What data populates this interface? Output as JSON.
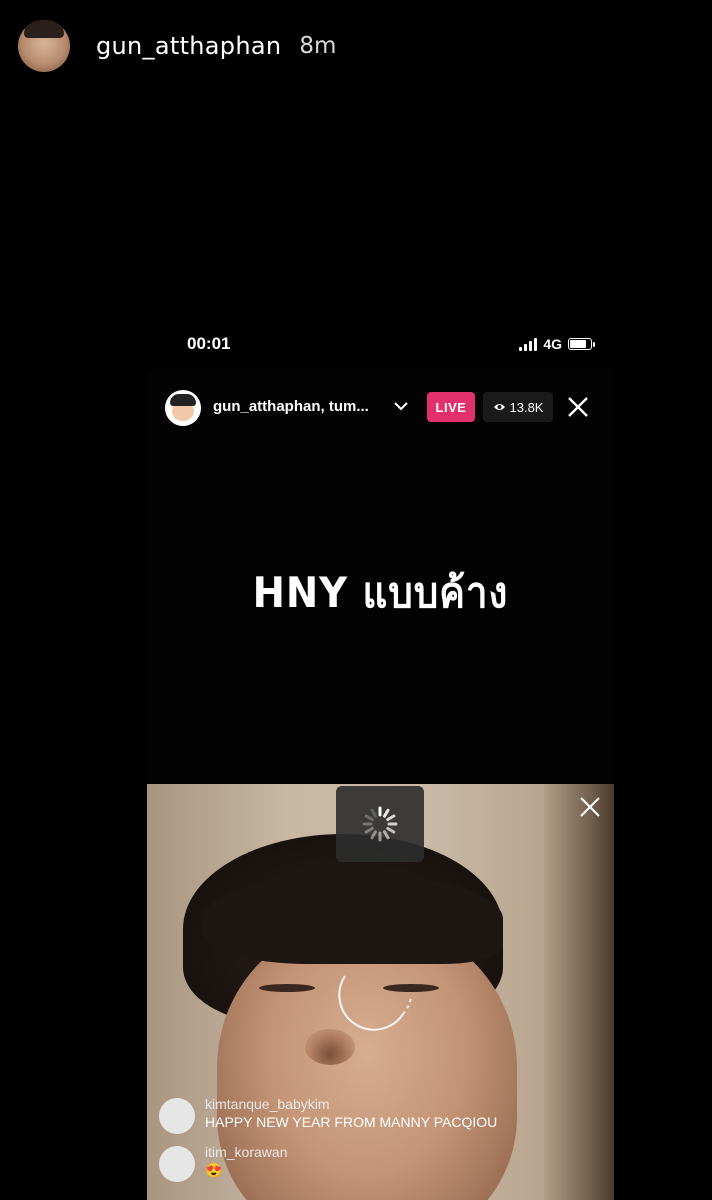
{
  "story": {
    "username": "gun_atthaphan",
    "time_ago": "8m",
    "avatar_icon": "profile-photo"
  },
  "status_bar": {
    "time": "00:01",
    "network": "4G",
    "signal_bars": 4,
    "battery_level": 0.8
  },
  "live": {
    "host_names": "gun_atthaphan, tum...",
    "badge": "LIVE",
    "viewers": "13.8K",
    "badge_color": "#e1306c",
    "caption": "HNY แบบค้าง"
  },
  "comments": [
    {
      "user": "kimtanque_babykim",
      "text": "HAPPY NEW YEAR FROM MANNY PACQIOU"
    },
    {
      "user": "itim_korawan",
      "text": "😍"
    }
  ]
}
